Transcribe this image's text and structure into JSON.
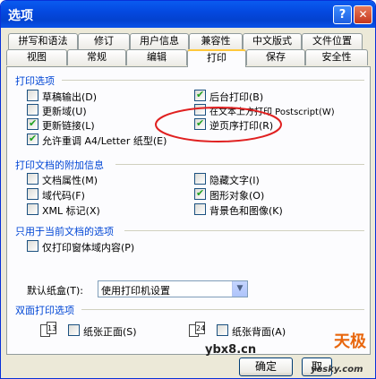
{
  "window": {
    "title": "选项"
  },
  "titlebar_buttons": {
    "help": "?",
    "close": "✕"
  },
  "tabs_row1": [
    "拼写和语法",
    "修订",
    "用户信息",
    "兼容性",
    "中文版式",
    "文件位置"
  ],
  "tabs_row2": [
    "视图",
    "常规",
    "编辑",
    "打印",
    "保存",
    "安全性"
  ],
  "active_tab": "打印",
  "print_options": {
    "title": "打印选项",
    "left": [
      {
        "label": "草稿输出(D)",
        "checked": false
      },
      {
        "label": "更新域(U)",
        "checked": false
      },
      {
        "label": "更新链接(L)",
        "checked": true
      },
      {
        "label": "允许重调 A4/Letter 纸型(E)",
        "checked": true
      }
    ],
    "right": [
      {
        "label": "后台打印(B)",
        "checked": true
      },
      {
        "label": "在文本上方打印 Postscript(W)",
        "checked": false
      },
      {
        "label": "逆页序打印(R)",
        "checked": true
      }
    ]
  },
  "doc_extras": {
    "title": "打印文档的附加信息",
    "left": [
      {
        "label": "文档属性(M)",
        "checked": false
      },
      {
        "label": "域代码(F)",
        "checked": false
      },
      {
        "label": "XML 标记(X)",
        "checked": false
      }
    ],
    "right": [
      {
        "label": "隐藏文字(I)",
        "checked": false
      },
      {
        "label": "图形对象(O)",
        "checked": true
      },
      {
        "label": "背景色和图像(K)",
        "checked": false
      }
    ]
  },
  "current_doc": {
    "title": "只用于当前文档的选项",
    "items": [
      {
        "label": "仅打印窗体域内容(P)",
        "checked": false
      }
    ]
  },
  "tray": {
    "label": "默认纸盒(T):",
    "value": "使用打印机设置"
  },
  "duplex": {
    "title": "双面打印选项",
    "front": {
      "label": "纸张正面(S)",
      "checked": false,
      "icon_text": "13"
    },
    "back": {
      "label": "纸张背面(A)",
      "checked": false,
      "icon_text": "24"
    }
  },
  "buttons": {
    "ok": "确定",
    "cancel": "取"
  },
  "watermarks": {
    "site1": "ybx8.cn",
    "brand": "天极",
    "site2": "yesky.com"
  },
  "colors": {
    "titlebar": "#0449e0",
    "section_title": "#0046d5",
    "annotation": "#e02020",
    "check": "#21a121"
  }
}
